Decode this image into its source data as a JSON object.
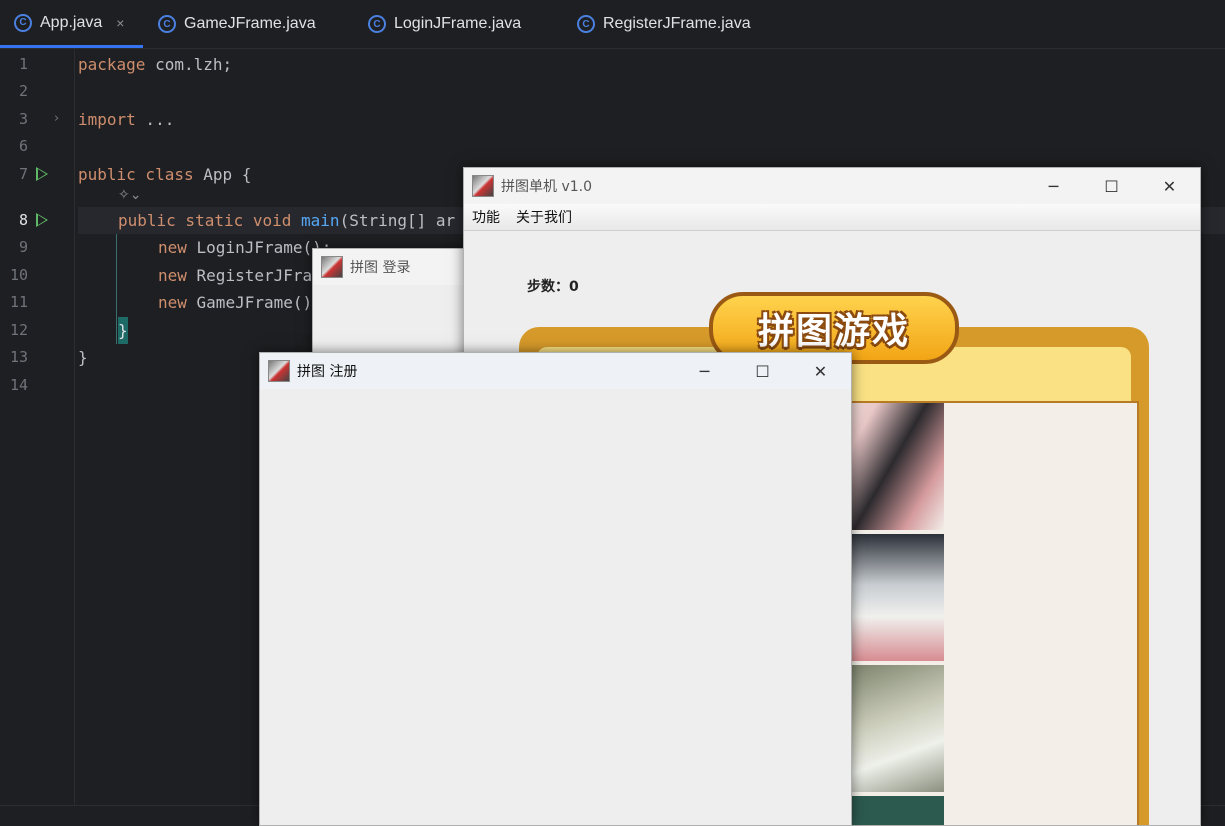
{
  "ide": {
    "tabs": [
      {
        "label": "App.java",
        "active": true
      },
      {
        "label": "GameJFrame.java",
        "active": false
      },
      {
        "label": "LoginJFrame.java",
        "active": false
      },
      {
        "label": "RegisterJFrame.java",
        "active": false
      }
    ],
    "close_glyph": "×",
    "line_numbers": [
      "1",
      "2",
      "3",
      "6",
      "7",
      "8",
      "9",
      "10",
      "11",
      "12",
      "13",
      "14"
    ],
    "code": {
      "l1_kw": "package",
      "l1_rest": " com.lzh;",
      "l3_kw": "import",
      "l3_rest": " ...",
      "l7_kw": "public class",
      "l7_rest": " App {",
      "l8_kw": "public static void",
      "l8_fn": " main",
      "l8_rest": "(String[] ar",
      "l9_kw": "new",
      "l9_rest": " LoginJFrame();",
      "l10_kw": "new",
      "l10_rest": " RegisterJFra",
      "l11_kw": "new",
      "l11_rest": " GameJFrame()",
      "l12": "}",
      "l13": "}"
    }
  },
  "game_window": {
    "title": "拼图单机 v1.0",
    "menu": [
      "功能",
      "关于我们"
    ],
    "steps_label": "步数：0",
    "logo_text": "拼图游戏"
  },
  "login_window": {
    "title": "拼图 登录"
  },
  "register_window": {
    "title": "拼图 注册"
  },
  "window_controls": {
    "minimize": "─",
    "maximize": "☐",
    "close": "✕"
  },
  "colors": {
    "accent": "#3574f0",
    "keyword": "#cf8e6d",
    "run": "#5fb865"
  }
}
